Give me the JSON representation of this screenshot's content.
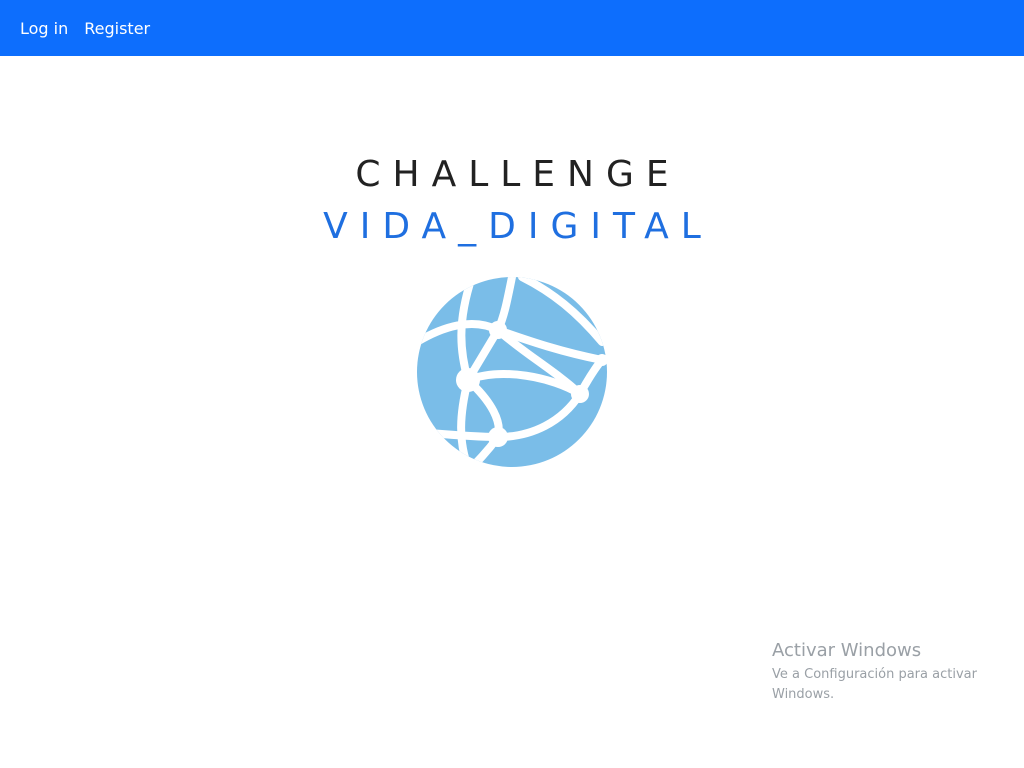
{
  "nav": {
    "login_label": "Log in",
    "register_label": "Register",
    "background_color": "#0d6efd"
  },
  "hero": {
    "title_line_1": "CHALLENGE",
    "title_line_2": "VIDA_DIGITAL",
    "title_line_2_color": "#1f6fe0",
    "logo_icon": "globe-network-icon",
    "logo_color": "#7abde8"
  },
  "watermark": {
    "title": "Activar Windows",
    "subtitle": "Ve a Configuración para activar Windows."
  }
}
